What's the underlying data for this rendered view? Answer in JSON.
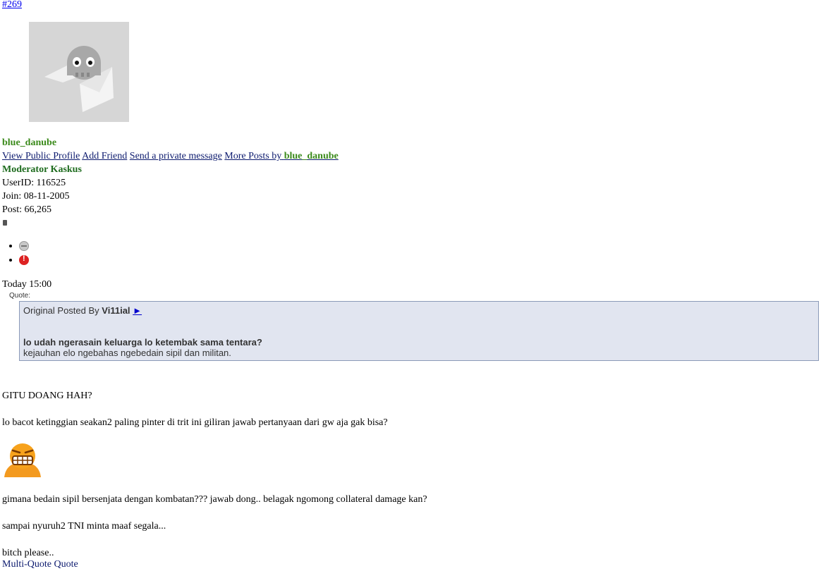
{
  "post": {
    "number": "#269",
    "username": "blue_danube",
    "links": {
      "view_profile": "View Public Profile",
      "add_friend": "Add Friend",
      "send_pm": "Send a private message",
      "more_posts_prefix": "More Posts by",
      "more_posts_user": "blue_danube"
    },
    "role": "Moderator Kaskus",
    "user_id": "UserID: 116525",
    "join": "Join: 08-11-2005",
    "posts": "Post: 66,265",
    "icons": [
      "offline-status-icon",
      "report-post-icon"
    ],
    "timestamp": "Today 15:00",
    "quote": {
      "label": "Quote:",
      "posted_by_prefix": "Original Posted By",
      "author": "Vi11ial",
      "link_arrow": "►",
      "bold_line": "lo udah ngerasain keluarga lo ketembak sama tentara?",
      "normal_line": "kejauhan elo ngebahas ngebedain sipil dan militan."
    },
    "body": {
      "line1": "GITU DOANG HAH?",
      "line2": "lo bacot ketinggian seakan2 paling pinter di trit ini giliran jawab pertanyaan dari gw aja gak bisa?",
      "smiley": "grinning-smiley",
      "line3": "gimana bedain sipil bersenjata dengan kombatan??? jawab dong.. belagak ngomong collateral damage kan?",
      "line4": "sampai nyuruh2 TNI minta maaf segala...",
      "line5": "bitch please.."
    },
    "bottom_links": "Multi-Quote Quote"
  },
  "colors": {
    "username": "#3a8a1a",
    "role": "#1d6b1d",
    "quote_bg": "#e1e5f0",
    "quote_border": "#8b9ab8",
    "link": "#0c1a6e"
  }
}
